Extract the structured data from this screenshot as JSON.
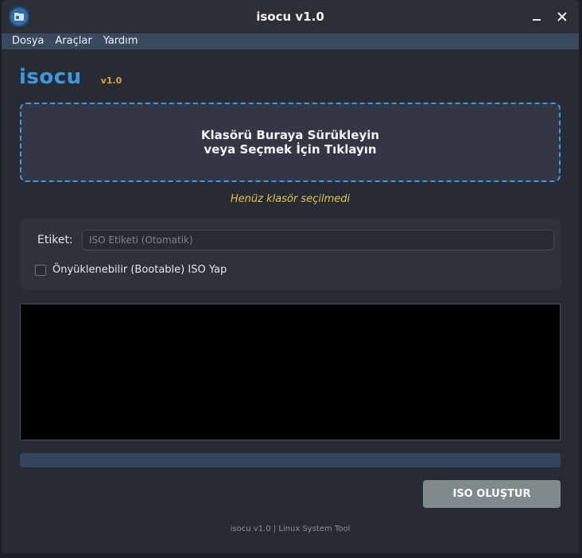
{
  "window": {
    "title": "isocu v1.0"
  },
  "menu": {
    "items": [
      "Dosya",
      "Araçlar",
      "Yardım"
    ]
  },
  "brand": {
    "name": "isocu",
    "version": "v1.0"
  },
  "dropzone": {
    "line1": "Klasörü Buraya Sürükleyin",
    "line2": "veya Seçmek İçin Tıklayın"
  },
  "status": {
    "text": "Henüz klasör seçilmedi"
  },
  "options": {
    "label_etiket": "Etiket:",
    "iso_label_placeholder": "ISO Etiketi (Otomatik)",
    "iso_label_value": "",
    "bootable_label": "Önyüklenebilir (Bootable) ISO Yap",
    "bootable_checked": false
  },
  "progress": {
    "value": 0
  },
  "actions": {
    "create_label": "ISO OLUŞTUR"
  },
  "footer": {
    "text": "isocu v1.0 | Linux System Tool"
  },
  "icons": {
    "app": "folder-disc-icon",
    "minimize": "minimize-icon",
    "close": "close-icon"
  },
  "colors": {
    "accent": "#3c9be0",
    "version": "#e0a23a",
    "status": "#e7c24a",
    "button": "#7f8a8a"
  }
}
